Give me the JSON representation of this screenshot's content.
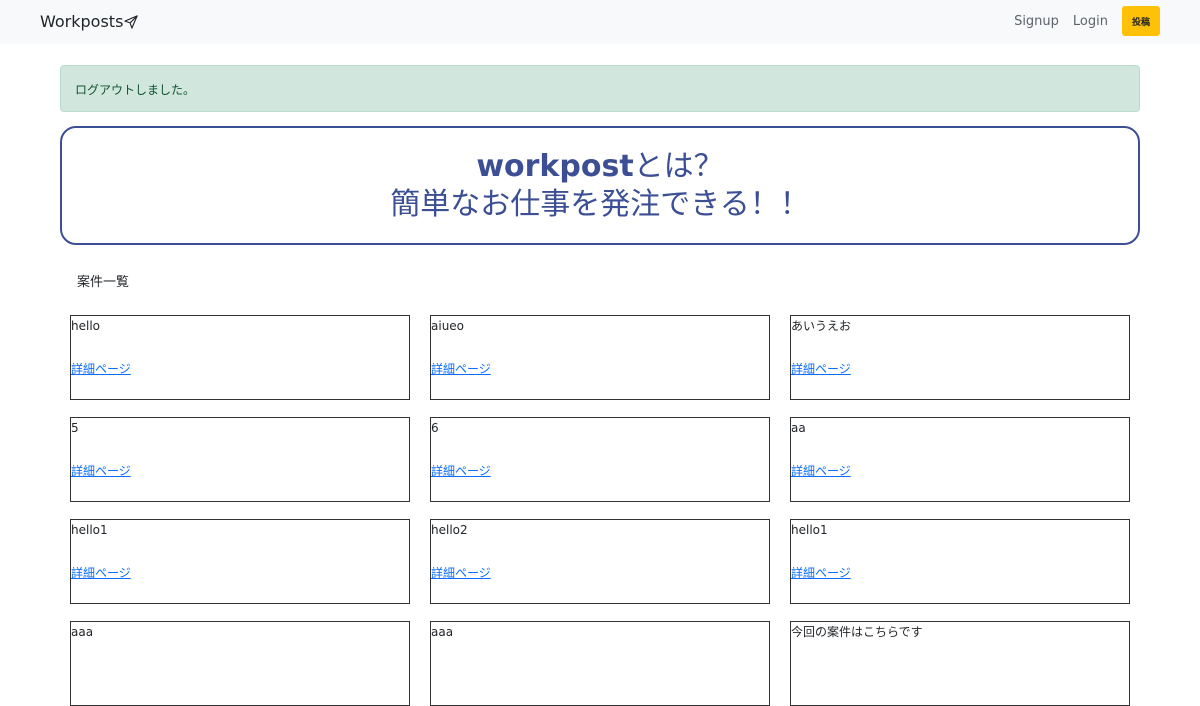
{
  "navbar": {
    "brand": "Workposts",
    "links": {
      "signup": "Signup",
      "login": "Login"
    },
    "post_button": "投稿"
  },
  "alert": {
    "message": "ログアウトしました。"
  },
  "hero": {
    "line1_bold": "workpost",
    "line1_rest": "とは？",
    "line2": "簡単なお仕事を発注できる！！"
  },
  "section": {
    "title": "案件一覧"
  },
  "cards": [
    {
      "title": "hello",
      "link": "詳細ページ"
    },
    {
      "title": "aiueo",
      "link": "詳細ページ"
    },
    {
      "title": "あいうえお",
      "link": "詳細ページ"
    },
    {
      "title": "5",
      "link": "詳細ページ"
    },
    {
      "title": "6",
      "link": "詳細ページ"
    },
    {
      "title": "aa",
      "link": "詳細ページ"
    },
    {
      "title": "hello1",
      "link": "詳細ページ"
    },
    {
      "title": "hello2",
      "link": "詳細ページ"
    },
    {
      "title": "hello1",
      "link": "詳細ページ"
    },
    {
      "title": "aaa",
      "link": ""
    },
    {
      "title": "aaa",
      "link": ""
    },
    {
      "title": "今回の案件はこちらです",
      "link": ""
    }
  ],
  "colors": {
    "accent": "#3c4f94",
    "alert_bg": "#d1e7dd",
    "button": "#ffc107",
    "link": "#0d6efd"
  },
  "icons": {
    "brand_icon": "paper-plane-icon"
  }
}
